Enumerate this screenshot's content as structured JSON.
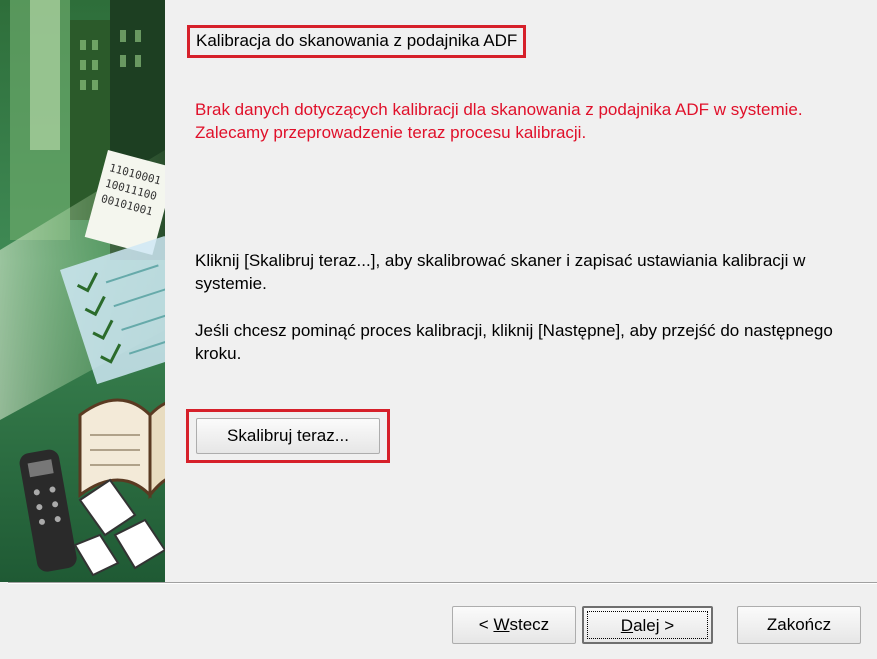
{
  "dialog": {
    "title": "Kalibracja do skanowania z podajnika ADF",
    "warning": "Brak danych dotyczących kalibracji dla skanowania z podajnika ADF w systemie. Zalecamy przeprowadzenie teraz procesu kalibracji.",
    "info_calibrate": "Kliknij [Skalibruj teraz...], aby skalibrować skaner i zapisać ustawiania kalibracji w systemie.",
    "info_skip": " Jeśli chcesz pominąć proces kalibracji, kliknij [Następne], aby przejść do następnego kroku.",
    "calibrate_button": "Skalibruj teraz..."
  },
  "footer": {
    "back_prefix": "< ",
    "back_mnemonic": "W",
    "back_rest": "stecz",
    "next_mnemonic": "D",
    "next_rest": "alej >",
    "finish": "Zakończ"
  },
  "sidebar": {
    "binary_lines": [
      "11010001",
      "10011100",
      "00101001"
    ]
  },
  "colors": {
    "highlight_border": "#d6202a",
    "warning_text": "#e0102a"
  }
}
